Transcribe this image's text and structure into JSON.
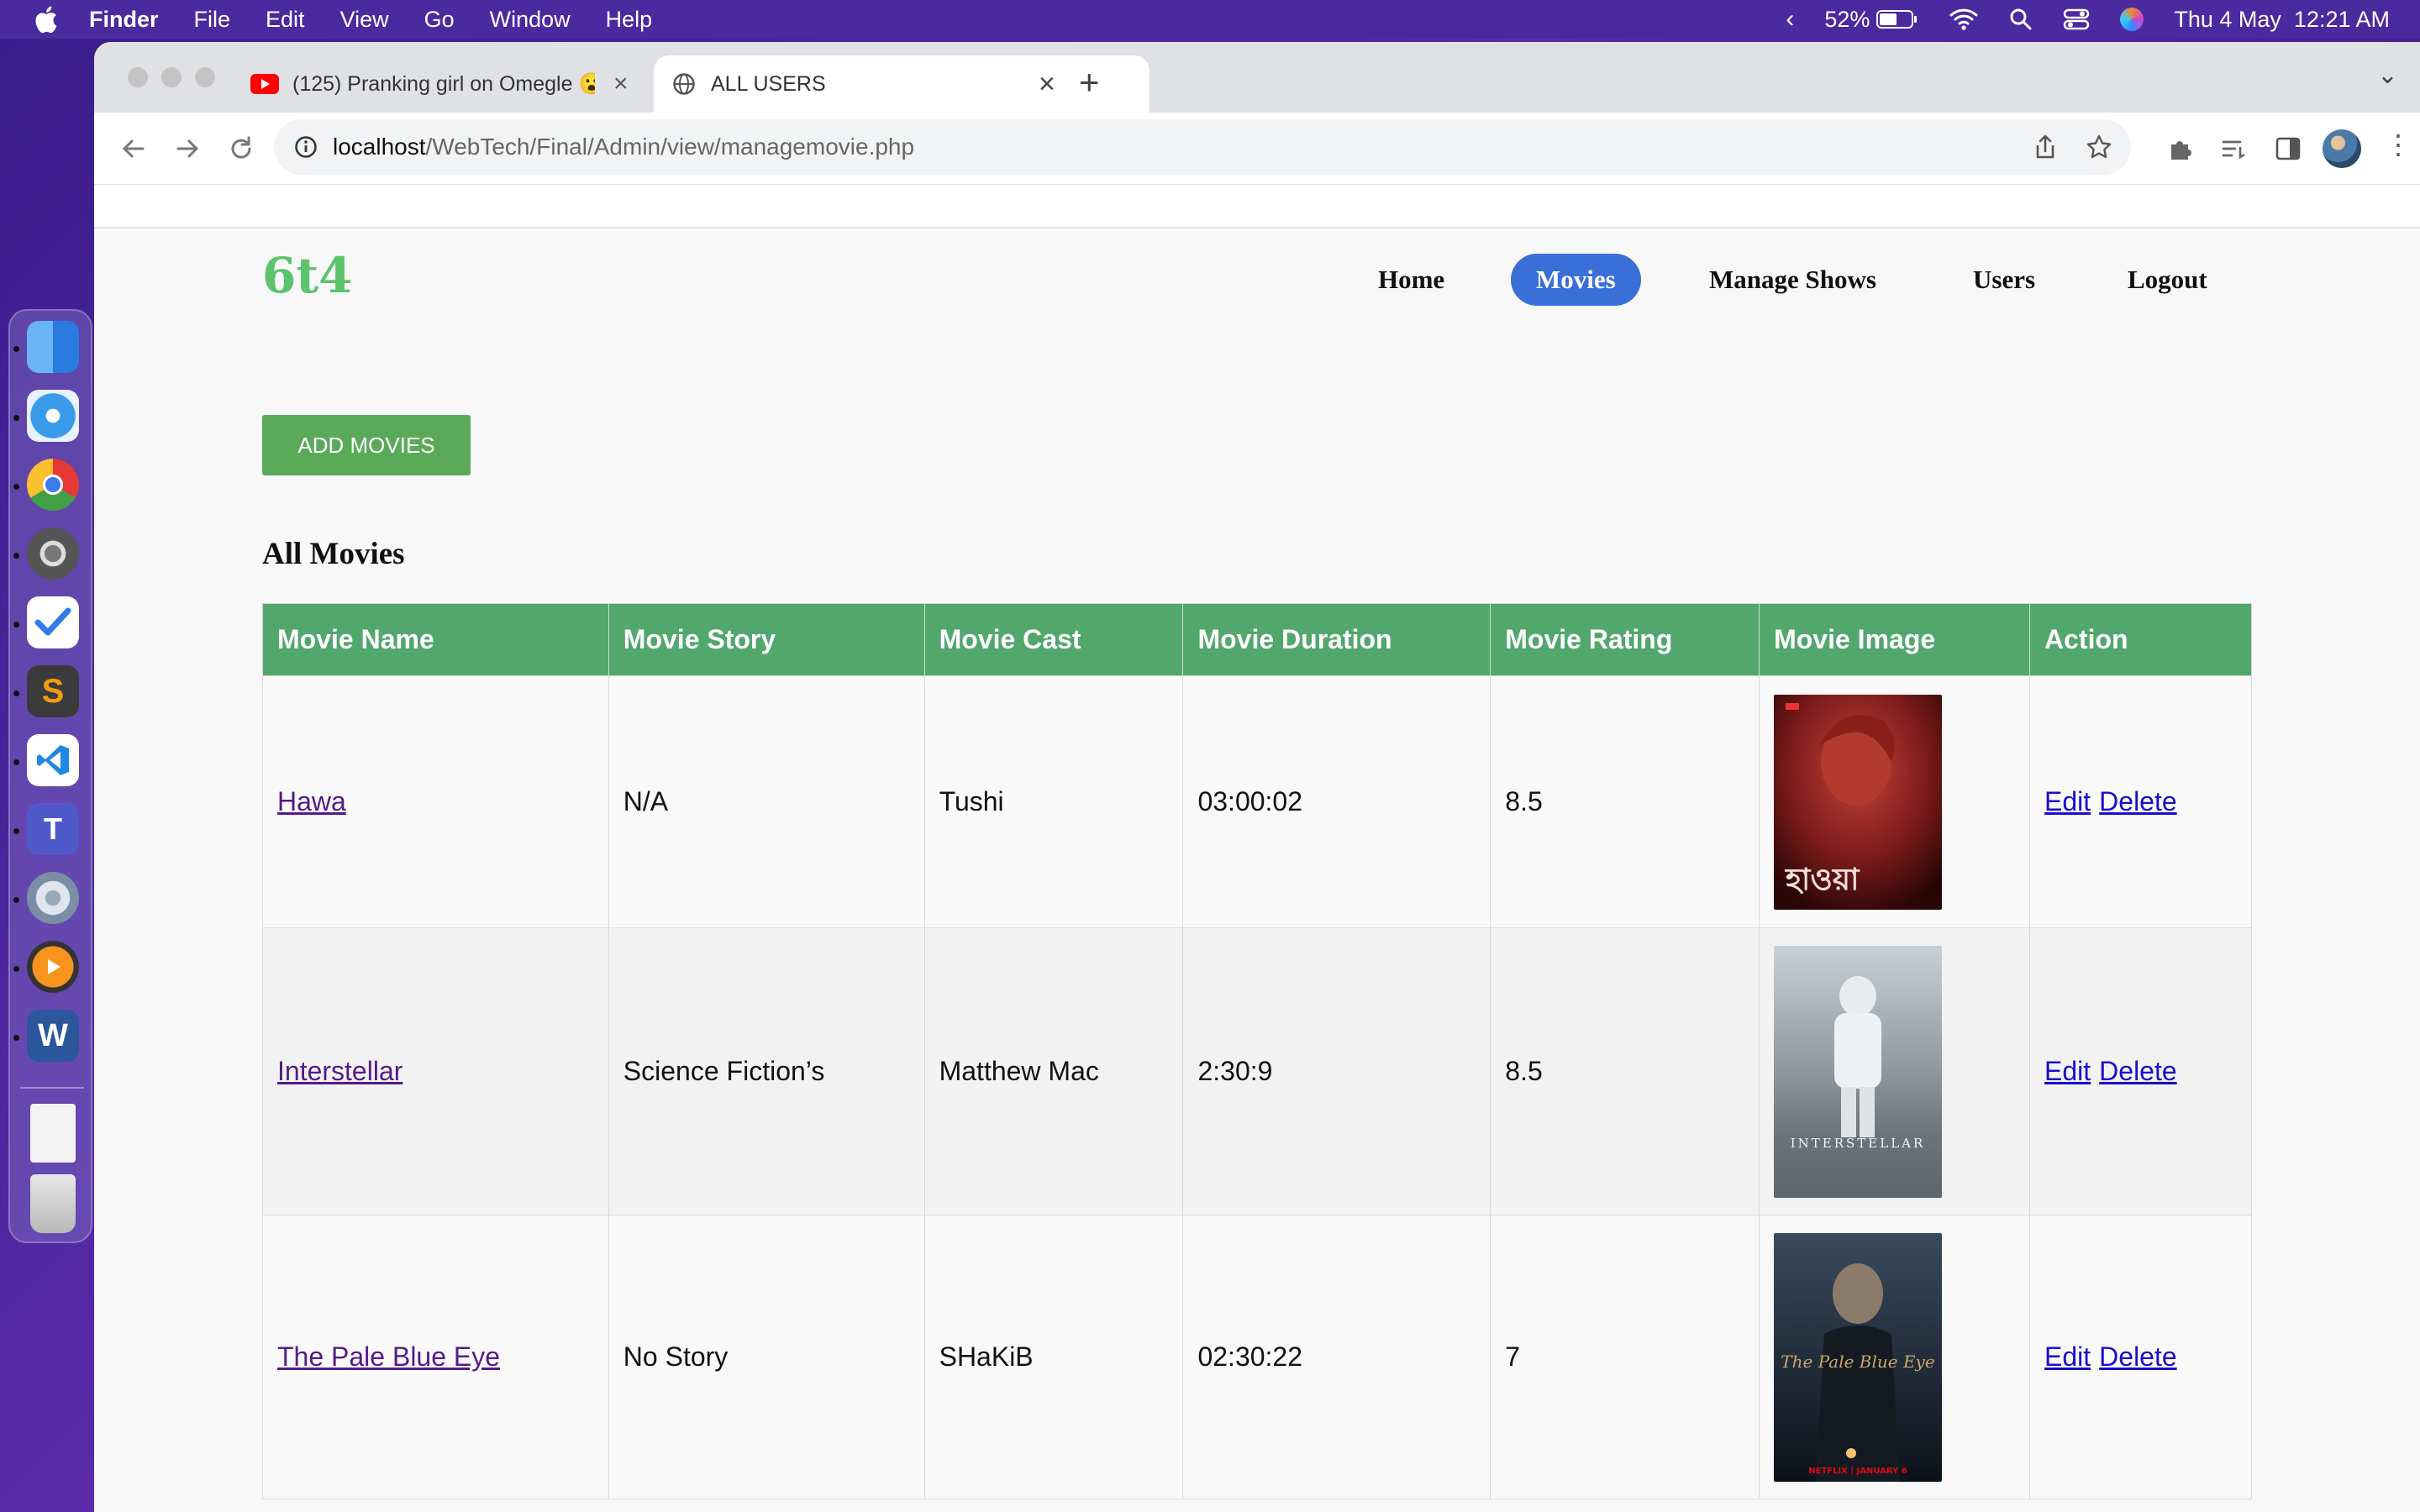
{
  "menubar": {
    "app": "Finder",
    "items": [
      "File",
      "Edit",
      "View",
      "Go",
      "Window",
      "Help"
    ],
    "battery": "52%",
    "datetime": "Thu 4 May  12:21 AM"
  },
  "browser": {
    "tabs": [
      {
        "title": "(125) Pranking girl on Omegle 😮",
        "icon": "youtube-icon"
      },
      {
        "title": "ALL USERS",
        "icon": "globe-icon"
      }
    ],
    "url_host": "localhost",
    "url_path": "/WebTech/Final/Admin/view/managemovie.php"
  },
  "site": {
    "logo": "6t4",
    "nav": [
      "Home",
      "Movies",
      "Manage Shows",
      "Users",
      "Logout"
    ],
    "active_nav": "Movies",
    "add_button": "ADD MOVIES",
    "heading": "All Movies"
  },
  "table": {
    "headers": [
      "Movie Name",
      "Movie Story",
      "Movie Cast",
      "Movie Duration",
      "Movie Rating",
      "Movie Image",
      "Action"
    ],
    "rows": [
      {
        "name": "Hawa",
        "story": "N/A",
        "cast": "Tushi",
        "duration": "03:00:02",
        "rating": "8.5",
        "edit": "Edit",
        "delete": "Delete"
      },
      {
        "name": "Interstellar",
        "story": "Science Fiction’s",
        "cast": "Matthew Mac",
        "duration": "2:30:9",
        "rating": "8.5",
        "edit": "Edit",
        "delete": "Delete"
      },
      {
        "name": "The Pale Blue Eye",
        "story": "No Story",
        "cast": "SHaKiB",
        "duration": "02:30:22",
        "rating": "7",
        "edit": "Edit",
        "delete": "Delete"
      }
    ]
  },
  "posters": [
    {
      "title_text": "হাওয়া"
    },
    {
      "title_text": "INTERSTELLAR"
    },
    {
      "title_text": "The Pale Blue Eye",
      "tag": "NETFLIX | JANUARY 6"
    }
  ],
  "colors": {
    "accent_nav": "#3a6fd8",
    "table_header": "#52a76c",
    "add_button": "#5aaa5a",
    "logo": "#5cc46a"
  },
  "dock_icons": [
    "finder-icon",
    "safari-icon",
    "chrome-icon",
    "system-settings-icon",
    "tasks-icon",
    "sublime-text-icon",
    "vscode-icon",
    "teams-icon",
    "settings-gear-icon",
    "media-player-icon",
    "word-icon",
    "document-icon",
    "trash-icon"
  ]
}
